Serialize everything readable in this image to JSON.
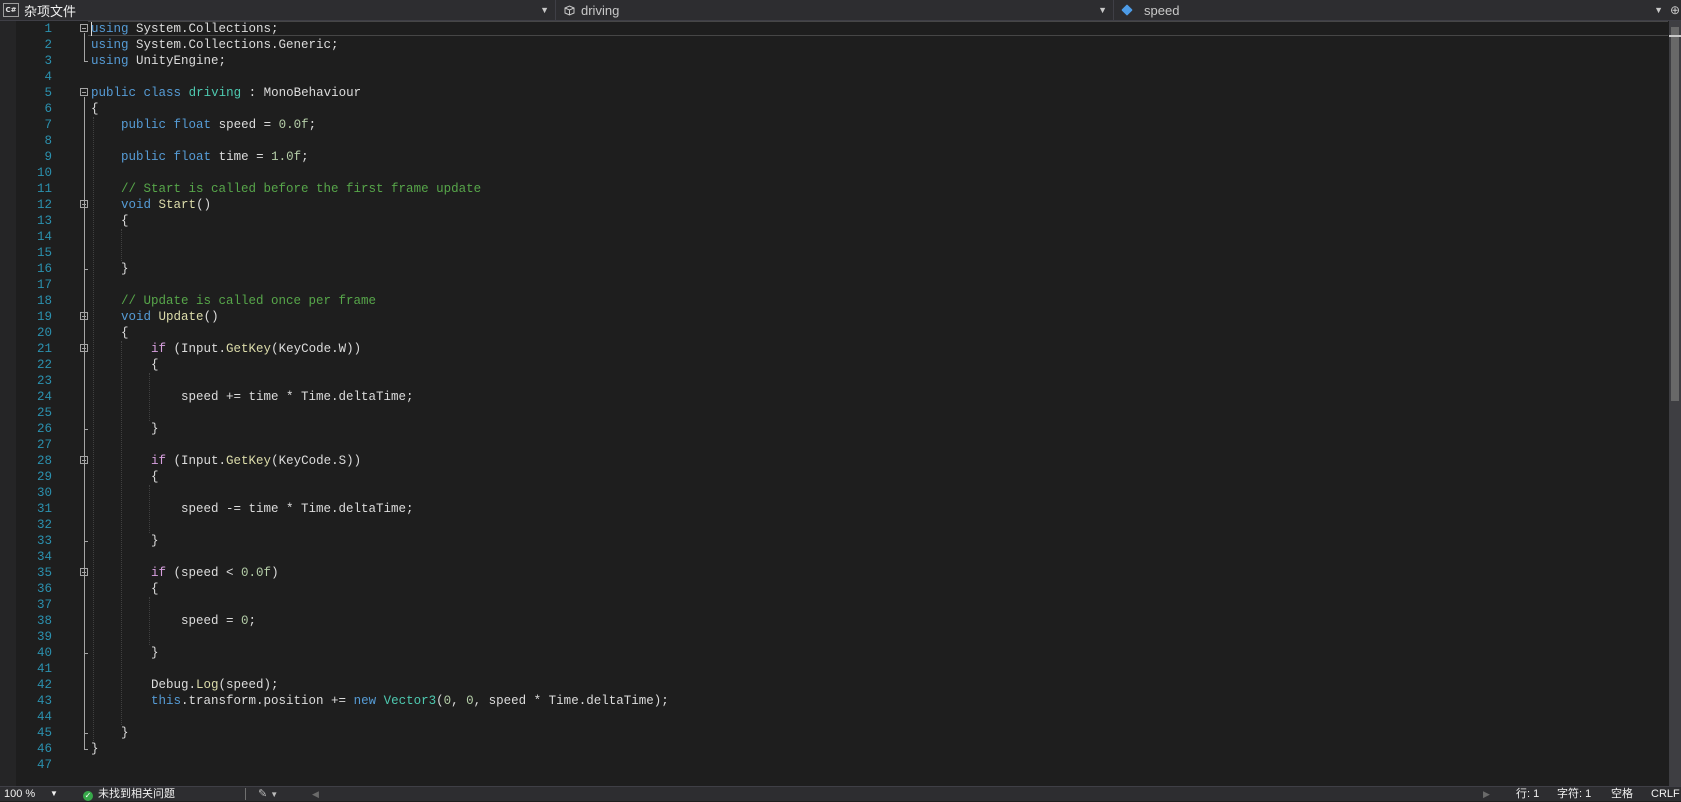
{
  "navbar": {
    "project": {
      "icon": "csharp-file-icon",
      "badge": "C#",
      "label": "杂项文件"
    },
    "type": {
      "icon": "class-icon",
      "label": "driving"
    },
    "member": {
      "icon": "field-icon",
      "label": "speed"
    },
    "split_icon": "split-window-icon"
  },
  "editor": {
    "lines": [
      {
        "n": "1",
        "fold": "open",
        "html": "<span class=\"kw\">using</span> System.Collections;"
      },
      {
        "n": "2",
        "fold": "",
        "html": "<span class=\"kw\">using</span> System.Collections.Generic;"
      },
      {
        "n": "3",
        "fold": "",
        "html": "<span class=\"kw\">using</span> UnityEngine;"
      },
      {
        "n": "4",
        "fold": "",
        "html": ""
      },
      {
        "n": "5",
        "fold": "open",
        "html": "<span class=\"kw\">public</span> <span class=\"kw\">class</span> <span class=\"typ\">driving</span> : MonoBehaviour"
      },
      {
        "n": "6",
        "fold": "",
        "html": "{"
      },
      {
        "n": "7",
        "fold": "",
        "html": "    <span class=\"kw\">public</span> <span class=\"kw\">float</span> speed = <span class=\"num\">0.0f</span>;"
      },
      {
        "n": "8",
        "fold": "",
        "html": ""
      },
      {
        "n": "9",
        "fold": "",
        "html": "    <span class=\"kw\">public</span> <span class=\"kw\">float</span> time = <span class=\"num\">1.0f</span>;"
      },
      {
        "n": "10",
        "fold": "",
        "html": ""
      },
      {
        "n": "11",
        "fold": "",
        "html": "    <span class=\"cmt\">// Start is called before the first frame update</span>"
      },
      {
        "n": "12",
        "fold": "open",
        "html": "    <span class=\"kw\">void</span> <span class=\"fn\">Start</span>()"
      },
      {
        "n": "13",
        "fold": "",
        "html": "    {"
      },
      {
        "n": "14",
        "fold": "",
        "html": ""
      },
      {
        "n": "15",
        "fold": "",
        "html": ""
      },
      {
        "n": "16",
        "fold": "",
        "html": "    }"
      },
      {
        "n": "17",
        "fold": "",
        "html": ""
      },
      {
        "n": "18",
        "fold": "",
        "html": "    <span class=\"cmt\">// Update is called once per frame</span>"
      },
      {
        "n": "19",
        "fold": "open",
        "html": "    <span class=\"kw\">void</span> <span class=\"fn\">Update</span>()"
      },
      {
        "n": "20",
        "fold": "",
        "html": "    {"
      },
      {
        "n": "21",
        "fold": "open",
        "html": "        <span class=\"ctl\">if</span> (Input.<span class=\"fn\">GetKey</span>(KeyCode.W))"
      },
      {
        "n": "22",
        "fold": "",
        "html": "        {"
      },
      {
        "n": "23",
        "fold": "",
        "html": ""
      },
      {
        "n": "24",
        "fold": "",
        "html": "            speed += time * Time.deltaTime;"
      },
      {
        "n": "25",
        "fold": "",
        "html": ""
      },
      {
        "n": "26",
        "fold": "",
        "html": "        }"
      },
      {
        "n": "27",
        "fold": "",
        "html": ""
      },
      {
        "n": "28",
        "fold": "open",
        "html": "        <span class=\"ctl\">if</span> (Input.<span class=\"fn\">GetKey</span>(KeyCode.S))"
      },
      {
        "n": "29",
        "fold": "",
        "html": "        {"
      },
      {
        "n": "30",
        "fold": "",
        "html": ""
      },
      {
        "n": "31",
        "fold": "",
        "html": "            speed -= time * Time.deltaTime;"
      },
      {
        "n": "32",
        "fold": "",
        "html": ""
      },
      {
        "n": "33",
        "fold": "",
        "html": "        }"
      },
      {
        "n": "34",
        "fold": "",
        "html": ""
      },
      {
        "n": "35",
        "fold": "open",
        "html": "        <span class=\"ctl\">if</span> (speed &lt; <span class=\"num\">0.0f</span>)"
      },
      {
        "n": "36",
        "fold": "",
        "html": "        {"
      },
      {
        "n": "37",
        "fold": "",
        "html": ""
      },
      {
        "n": "38",
        "fold": "",
        "html": "            speed = <span class=\"num\">0</span>;"
      },
      {
        "n": "39",
        "fold": "",
        "html": ""
      },
      {
        "n": "40",
        "fold": "",
        "html": "        }"
      },
      {
        "n": "41",
        "fold": "",
        "html": ""
      },
      {
        "n": "42",
        "fold": "",
        "html": "        Debug.<span class=\"fn\">Log</span>(speed);"
      },
      {
        "n": "43",
        "fold": "",
        "html": "        <span class=\"kw\">this</span>.transform.position += <span class=\"kw\">new</span> <span class=\"typ\">Vector3</span>(<span class=\"num\">0</span>, <span class=\"num\">0</span>, speed * Time.deltaTime);"
      },
      {
        "n": "44",
        "fold": "",
        "html": ""
      },
      {
        "n": "45",
        "fold": "",
        "html": "    }"
      },
      {
        "n": "46",
        "fold": "",
        "html": "}"
      },
      {
        "n": "47",
        "fold": "",
        "html": ""
      }
    ],
    "colors": {
      "background": "#1e1e1e",
      "line_number": "#2b91af",
      "keyword": "#569cd6",
      "control": "#d8a0df",
      "type": "#4ec9b0",
      "comment": "#57a64a",
      "number": "#b5cea8",
      "method": "#dcdcaa"
    }
  },
  "status": {
    "zoom": "100 %",
    "issues_icon": "check-circle-icon",
    "issues_text": "未找到相关问题",
    "brush_icon": "code-cleanup-icon",
    "line": "行: 1",
    "char": "字符: 1",
    "spaces": "空格",
    "eol": "CRLF"
  }
}
